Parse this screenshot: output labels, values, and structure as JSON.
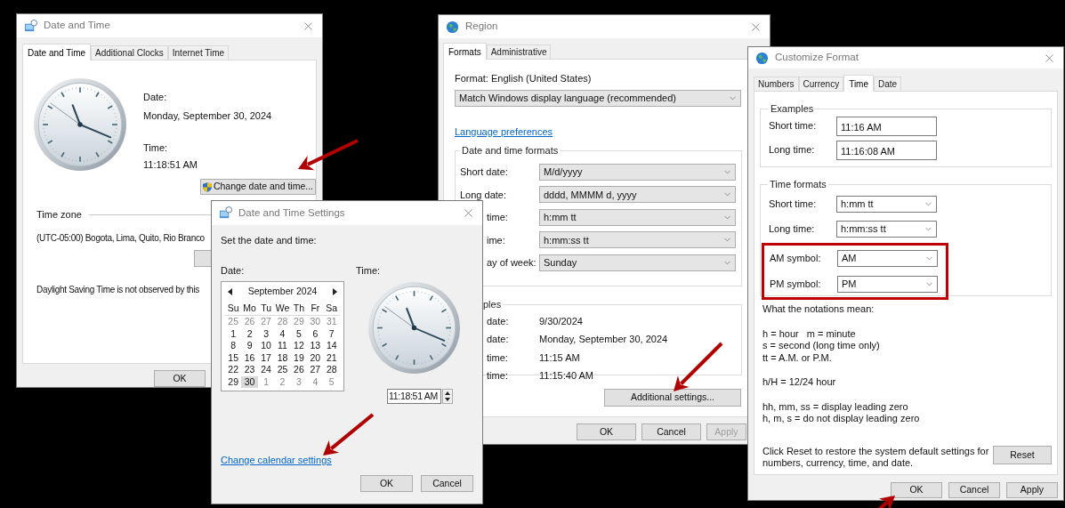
{
  "date_time_window": {
    "title": "Date and Time",
    "tabs": [
      {
        "label": "Date and Time",
        "selected": true
      },
      {
        "label": "Additional Clocks",
        "selected": false
      },
      {
        "label": "Internet Time",
        "selected": false
      }
    ],
    "date_label": "Date:",
    "date_value": "Monday, September 30, 2024",
    "time_label": "Time:",
    "time_value": "11:18:51 AM",
    "change_button": "Change date and time...",
    "time_zone_heading": "Time zone",
    "time_zone_value": "(UTC-05:00) Bogota, Lima, Quito, Rio Branco",
    "dst_note": "Daylight Saving Time is not observed by this",
    "ok_button": "OK"
  },
  "settings_window": {
    "title": "Date and Time Settings",
    "prompt": "Set the date and time:",
    "date_label": "Date:",
    "calendar": {
      "month": "September 2024",
      "weekdays": [
        "Su",
        "Mo",
        "Tu",
        "We",
        "Th",
        "Fr",
        "Sa"
      ],
      "days": [
        {
          "label": "25",
          "muted": true,
          "selected": false
        },
        {
          "label": "26",
          "muted": true,
          "selected": false
        },
        {
          "label": "27",
          "muted": true,
          "selected": false
        },
        {
          "label": "28",
          "muted": true,
          "selected": false
        },
        {
          "label": "29",
          "muted": true,
          "selected": false
        },
        {
          "label": "30",
          "muted": true,
          "selected": false
        },
        {
          "label": "31",
          "muted": true,
          "selected": false
        },
        {
          "label": "1",
          "muted": false,
          "selected": false
        },
        {
          "label": "2",
          "muted": false,
          "selected": false
        },
        {
          "label": "3",
          "muted": false,
          "selected": false
        },
        {
          "label": "4",
          "muted": false,
          "selected": false
        },
        {
          "label": "5",
          "muted": false,
          "selected": false
        },
        {
          "label": "6",
          "muted": false,
          "selected": false
        },
        {
          "label": "7",
          "muted": false,
          "selected": false
        },
        {
          "label": "8",
          "muted": false,
          "selected": false
        },
        {
          "label": "9",
          "muted": false,
          "selected": false
        },
        {
          "label": "10",
          "muted": false,
          "selected": false
        },
        {
          "label": "11",
          "muted": false,
          "selected": false
        },
        {
          "label": "12",
          "muted": false,
          "selected": false
        },
        {
          "label": "13",
          "muted": false,
          "selected": false
        },
        {
          "label": "14",
          "muted": false,
          "selected": false
        },
        {
          "label": "15",
          "muted": false,
          "selected": false
        },
        {
          "label": "16",
          "muted": false,
          "selected": false
        },
        {
          "label": "17",
          "muted": false,
          "selected": false
        },
        {
          "label": "18",
          "muted": false,
          "selected": false
        },
        {
          "label": "19",
          "muted": false,
          "selected": false
        },
        {
          "label": "20",
          "muted": false,
          "selected": false
        },
        {
          "label": "21",
          "muted": false,
          "selected": false
        },
        {
          "label": "22",
          "muted": false,
          "selected": false
        },
        {
          "label": "23",
          "muted": false,
          "selected": false
        },
        {
          "label": "24",
          "muted": false,
          "selected": false
        },
        {
          "label": "25",
          "muted": false,
          "selected": false
        },
        {
          "label": "26",
          "muted": false,
          "selected": false
        },
        {
          "label": "27",
          "muted": false,
          "selected": false
        },
        {
          "label": "28",
          "muted": false,
          "selected": false
        },
        {
          "label": "29",
          "muted": false,
          "selected": false
        },
        {
          "label": "30",
          "muted": false,
          "selected": true
        },
        {
          "label": "1",
          "muted": true,
          "selected": false
        },
        {
          "label": "2",
          "muted": true,
          "selected": false
        },
        {
          "label": "3",
          "muted": true,
          "selected": false
        },
        {
          "label": "4",
          "muted": true,
          "selected": false
        },
        {
          "label": "5",
          "muted": true,
          "selected": false
        }
      ]
    },
    "time_label": "Time:",
    "time_value": "11:18:51 AM",
    "link": "Change calendar settings",
    "buttons": [
      "OK",
      "Cancel"
    ]
  },
  "region_window": {
    "title": "Region",
    "tabs": [
      {
        "label": "Formats",
        "selected": true
      },
      {
        "label": "Administrative",
        "selected": false
      }
    ],
    "format_label": "Format: English (United States)",
    "format_select": "Match Windows display language (recommended)",
    "link": "Language preferences",
    "formats_group": {
      "title": "Date and time formats",
      "rows": [
        {
          "label": "Short date:",
          "value": "M/d/yyyy",
          "covered": false
        },
        {
          "label": "Long date:",
          "value": "dddd, MMMM d, yyyy",
          "covered": false
        },
        {
          "label": "time:",
          "value": "h:mm tt",
          "covered": true
        },
        {
          "label": "ime:",
          "value": "h:mm:ss tt",
          "covered": true
        },
        {
          "label": "ay of week:",
          "value": "Sunday",
          "covered": true
        }
      ]
    },
    "examples_group": {
      "title": "ples",
      "rows": [
        {
          "label": "date:",
          "value": "9/30/2024"
        },
        {
          "label": "date:",
          "value": "Monday, September 30, 2024"
        },
        {
          "label": "time:",
          "value": "11:15 AM"
        },
        {
          "label": "time:",
          "value": "11:15:40 AM"
        }
      ]
    },
    "additional_button": "Additional settings...",
    "buttons": [
      {
        "label": "OK",
        "disabled": false
      },
      {
        "label": "Cancel",
        "disabled": false
      },
      {
        "label": "Apply",
        "disabled": true
      }
    ]
  },
  "customize_window": {
    "title": "Customize Format",
    "tabs": [
      {
        "label": "Numbers",
        "selected": false
      },
      {
        "label": "Currency",
        "selected": false
      },
      {
        "label": "Time",
        "selected": true
      },
      {
        "label": "Date",
        "selected": false
      }
    ],
    "examples": {
      "title": "Examples",
      "rows": [
        {
          "label": "Short time:",
          "value": "11:16 AM"
        },
        {
          "label": "Long time:",
          "value": "11:16:08 AM"
        }
      ]
    },
    "time_formats": {
      "title": "Time formats",
      "rows": [
        {
          "label": "Short time:",
          "value": "h:mm tt",
          "highlighted": false
        },
        {
          "label": "Long time:",
          "value": "h:mm:ss tt",
          "highlighted": false
        },
        {
          "label": "AM symbol:",
          "value": "AM",
          "highlighted": true
        },
        {
          "label": "PM symbol:",
          "value": "PM",
          "highlighted": true
        }
      ]
    },
    "notes": [
      [
        "What the notations mean:"
      ],
      [
        "h = hour   m = minute",
        "s = second (long time only)",
        "tt = A.M. or P.M."
      ],
      [
        "h/H = 12/24 hour"
      ],
      [
        "hh, mm, ss = display leading zero",
        "h, m, s = do not display leading zero"
      ]
    ],
    "reset_note": "Click Reset to restore the system default settings for numbers, currency, time, and date.",
    "reset_button": "Reset",
    "buttons": [
      "OK",
      "Cancel",
      "Apply"
    ]
  }
}
